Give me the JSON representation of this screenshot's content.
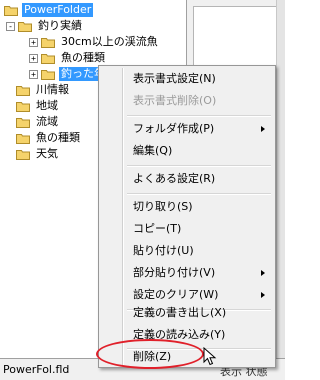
{
  "tree": {
    "items": [
      {
        "label": "PowerFolder",
        "expander": "",
        "selected": true
      },
      {
        "label": "釣り実績",
        "expander": "-",
        "selected": false
      },
      {
        "label": "30cm以上の渓流魚",
        "expander": "+",
        "selected": false
      },
      {
        "label": "魚の種類",
        "expander": "+",
        "selected": false
      },
      {
        "label": "釣った年月",
        "expander": "+",
        "selected": true
      },
      {
        "label": "川情報",
        "expander": "",
        "selected": false
      },
      {
        "label": "地域",
        "expander": "",
        "selected": false
      },
      {
        "label": "流域",
        "expander": "",
        "selected": false
      },
      {
        "label": "魚の種類",
        "expander": "",
        "selected": false
      },
      {
        "label": "天気",
        "expander": "",
        "selected": false
      }
    ]
  },
  "context_menu": {
    "items": [
      {
        "label": "表示書式設定(N)",
        "disabled": false,
        "submenu": false
      },
      {
        "label": "表示書式削除(O)",
        "disabled": true,
        "submenu": false
      },
      {
        "label": "フォルダ作成(P)",
        "disabled": false,
        "submenu": true
      },
      {
        "label": "編集(Q)",
        "disabled": false,
        "submenu": false
      },
      {
        "label": "よくある設定(R)",
        "disabled": false,
        "submenu": false
      },
      {
        "label": "切り取り(S)",
        "disabled": false,
        "submenu": false
      },
      {
        "label": "コピー(T)",
        "disabled": false,
        "submenu": false
      },
      {
        "label": "貼り付け(U)",
        "disabled": false,
        "submenu": false
      },
      {
        "label": "部分貼り付け(V)",
        "disabled": false,
        "submenu": true
      },
      {
        "label": "設定のクリア(W)",
        "disabled": false,
        "submenu": true
      },
      {
        "label": "定義の書き出し(X)",
        "disabled": false,
        "submenu": false
      },
      {
        "label": "定義の読み込み(Y)",
        "disabled": false,
        "submenu": false
      },
      {
        "label": "削除(Z)",
        "disabled": false,
        "submenu": false
      }
    ]
  },
  "statusbar": {
    "file": "PowerFol.fld",
    "right_text": "表示  状態"
  },
  "colors": {
    "selection": "#3399ff",
    "folder": "#f5d36b",
    "highlight_ellipse": "#e0202a"
  }
}
